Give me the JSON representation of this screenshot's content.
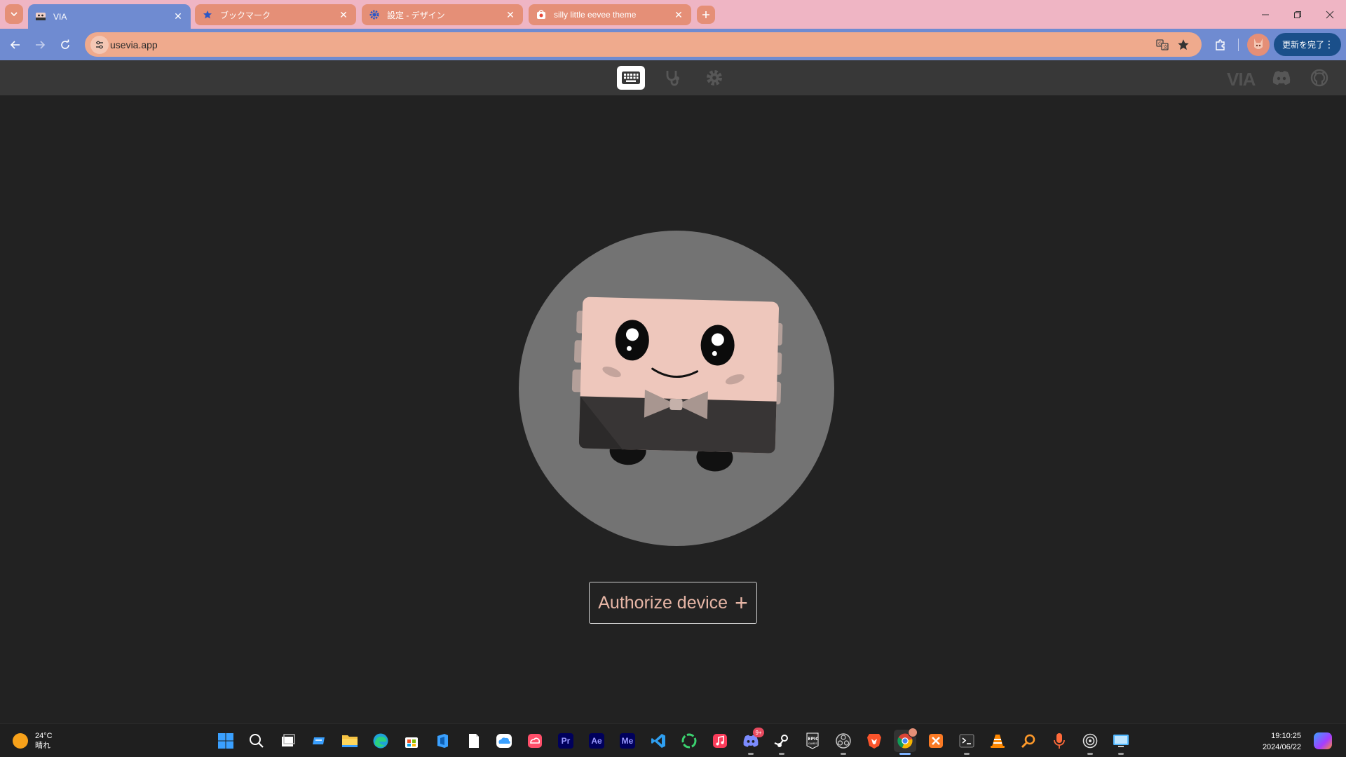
{
  "browser": {
    "tabs": [
      {
        "title": "VIA",
        "active": true,
        "favicon": "via-mascot-icon"
      },
      {
        "title": "ブックマーク",
        "active": false,
        "favicon": "star-icon"
      },
      {
        "title": "設定 - デザイン",
        "active": false,
        "favicon": "gear-icon"
      },
      {
        "title": "silly little eevee theme",
        "active": false,
        "favicon": "chrome-web-store-icon"
      }
    ],
    "url": "usevia.app",
    "update_button": "更新を完了",
    "colors": {
      "tabstrip": "#efb5c4",
      "toolbar": "#6f8bd1",
      "tab_inactive": "#e58f77",
      "omnibox": "#efaa8d"
    }
  },
  "app": {
    "nav": [
      "keyboard-icon",
      "stethoscope-icon",
      "gear-icon"
    ],
    "logo": "VIA",
    "header_links": [
      "discord-icon",
      "github-icon"
    ],
    "authorize_button": "Authorize device",
    "colors": {
      "header": "#383838",
      "background": "#222222",
      "accent": "#e7b6a6"
    }
  },
  "taskbar": {
    "weather": {
      "temp": "24°C",
      "condition": "晴れ"
    },
    "apps": [
      "windows-start-icon",
      "search-icon",
      "task-view-icon",
      "widgets-icon",
      "file-explorer-icon",
      "edge-icon",
      "microsoft-store-icon",
      "office-icon",
      "notepad-icon",
      "onedrive-icon",
      "creative-cloud-icon",
      "Pr",
      "Ae",
      "Me",
      "vscode-icon",
      "ring-app-icon",
      "apple-music-icon",
      "discord-icon",
      "steam-icon",
      "epic-games-icon",
      "obs-icon",
      "brave-icon",
      "chrome-icon",
      "xampp-icon",
      "terminal-icon",
      "vlc-icon",
      "magnifier-icon",
      "microphone-icon",
      "davinci-icon",
      "remote-desktop-icon"
    ],
    "discord_badge": "9+",
    "clock": {
      "time": "19:10:25",
      "date": "2024/06/22"
    }
  }
}
